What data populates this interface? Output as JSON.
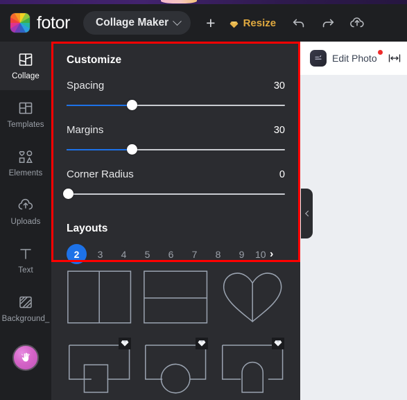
{
  "app": {
    "brand": "fotor",
    "mode": "Collage Maker",
    "logo_colors": [
      "#f2d024",
      "#8fc63d",
      "#3fae49",
      "#23b5a6",
      "#2d9fdc",
      "#2f63c4",
      "#6a3fb5",
      "#a736b0",
      "#e0348c",
      "#ef3e3e",
      "#f4692c",
      "#f59a22"
    ]
  },
  "header": {
    "add_label": "+",
    "resize_label": "Resize",
    "resize_color": "#e0a93f",
    "undo_icon": "undo-arrow-icon",
    "redo_icon": "redo-arrow-icon",
    "cloud_icon": "cloud-upload-icon",
    "dropdown_icon": "chevron-down-icon"
  },
  "sidebar": {
    "items": [
      {
        "label": "Collage",
        "icon": "collage-grid-icon",
        "active": true
      },
      {
        "label": "Templates",
        "icon": "templates-grid-icon",
        "active": false
      },
      {
        "label": "Elements",
        "icon": "shapes-icon",
        "active": false
      },
      {
        "label": "Uploads",
        "icon": "cloud-upload-icon",
        "active": false
      },
      {
        "label": "Text",
        "icon": "text-t-icon",
        "active": false
      },
      {
        "label": "Background_",
        "icon": "background-hatch-icon",
        "active": false
      }
    ],
    "assistant_icon": "hand-pan-icon"
  },
  "panel": {
    "title": "Customize",
    "accent_color": "#1d72e8",
    "sliders": [
      {
        "name": "Spacing",
        "value": "30",
        "percent": 30
      },
      {
        "name": "Margins",
        "value": "30",
        "percent": 30
      },
      {
        "name": "Corner Radius",
        "value": "0",
        "percent": 0
      }
    ],
    "layouts": {
      "title": "Layouts",
      "pages": [
        "2",
        "3",
        "4",
        "5",
        "6",
        "7",
        "8",
        "9",
        "10"
      ],
      "selected_page": "2",
      "next_icon": "chevron-right-icon",
      "thumbnails": [
        {
          "name": "two-column-split",
          "premium": false
        },
        {
          "name": "two-row-split",
          "premium": false
        },
        {
          "name": "heart-split",
          "premium": false
        },
        {
          "name": "frame-with-square",
          "premium": true
        },
        {
          "name": "frame-with-circle",
          "premium": true
        },
        {
          "name": "frame-with-arch",
          "premium": true
        }
      ]
    }
  },
  "stage": {
    "edit_photo_label": "Edit Photo",
    "edit_photo_icon": "photo-edit-icon",
    "notification_dot_color": "#ef2b2b",
    "width_icon": "width-resize-icon",
    "collapse_icon": "chevron-left-icon"
  },
  "highlight": {
    "color": "#ff0000"
  }
}
